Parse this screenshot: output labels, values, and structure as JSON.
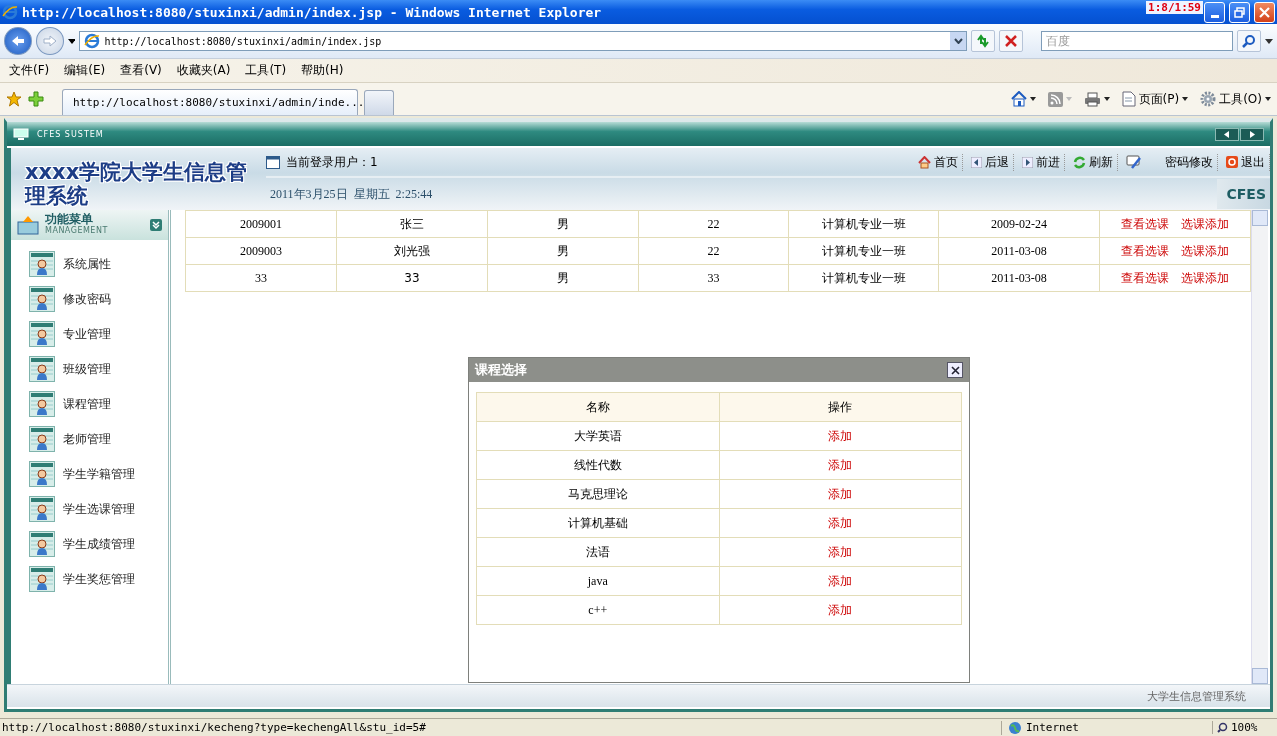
{
  "window": {
    "title": "http://localhost:8080/stuxinxi/admin/index.jsp - Windows Internet Explorer"
  },
  "overlay_counter": "1:8/1:59",
  "address_bar": {
    "value": "http://localhost:8080/stuxinxi/admin/index.jsp"
  },
  "search": {
    "placeholder": "百度"
  },
  "menu": [
    "文件(F)",
    "编辑(E)",
    "查看(V)",
    "收藏夹(A)",
    "工具(T)",
    "帮助(H)"
  ],
  "tabs": [
    {
      "label": "http://localhost:8080/stuxinxi/admin/inde...",
      "selected": true
    }
  ],
  "command_bar": [
    {
      "kind": "home"
    },
    {
      "kind": "feed"
    },
    {
      "kind": "print"
    },
    {
      "kind": "page",
      "label": "页面(P)"
    },
    {
      "kind": "tools",
      "label": "工具(O)"
    }
  ],
  "app": {
    "frame_title": "CFES SUSTEM",
    "system_title": "xxxx学院大学生信息管理系统",
    "login_label": "当前登录用户：1",
    "datetime": "2011年3月25日  星期五  2:25:44",
    "badge": "CFES",
    "nav": [
      {
        "kind": "home",
        "label": "首页"
      },
      {
        "kind": "back",
        "label": "后退"
      },
      {
        "kind": "forward",
        "label": "前进"
      },
      {
        "kind": "refresh",
        "label": "刷新"
      },
      {
        "kind": "edit",
        "label": "密码修改"
      },
      {
        "kind": "exit",
        "label": "退出"
      }
    ],
    "sidebar": {
      "title": "功能菜单",
      "subtitle": "MANAGEMENT",
      "items": [
        "系统属性",
        "修改密码",
        "专业管理",
        "班级管理",
        "课程管理",
        "老师管理",
        "学生学籍管理",
        "学生选课管理",
        "学生成绩管理",
        "学生奖惩管理"
      ]
    },
    "table": {
      "rows": [
        {
          "cells": [
            "2009001",
            "张三",
            "男",
            "22",
            "计算机专业一班",
            "2009-02-24"
          ],
          "actions": [
            "查看选课",
            "选课添加"
          ]
        },
        {
          "cells": [
            "2009003",
            "刘光强",
            "男",
            "22",
            "计算机专业一班",
            "2011-03-08"
          ],
          "actions": [
            "查看选课",
            "选课添加"
          ]
        },
        {
          "cells": [
            "33",
            "33",
            "男",
            "33",
            "计算机专业一班",
            "2011-03-08"
          ],
          "actions": [
            "查看选课",
            "选课添加"
          ]
        }
      ]
    },
    "dialog": {
      "title": "课程选择",
      "columns": [
        "名称",
        "操作"
      ],
      "rows": [
        {
          "name": "大学英语",
          "action": "添加"
        },
        {
          "name": "线性代数",
          "action": "添加"
        },
        {
          "name": "马克思理论",
          "action": "添加"
        },
        {
          "name": "计算机基础",
          "action": "添加"
        },
        {
          "name": "法语",
          "action": "添加"
        },
        {
          "name": "java",
          "action": "添加"
        },
        {
          "name": "c++",
          "action": "添加"
        }
      ]
    },
    "footer": "大学生信息管理系统"
  },
  "status_bar": {
    "url": "http://localhost:8080/stuxinxi/kecheng?type=kechengAll&stu_id=5#",
    "zone": "Internet",
    "zoom": "100%"
  }
}
